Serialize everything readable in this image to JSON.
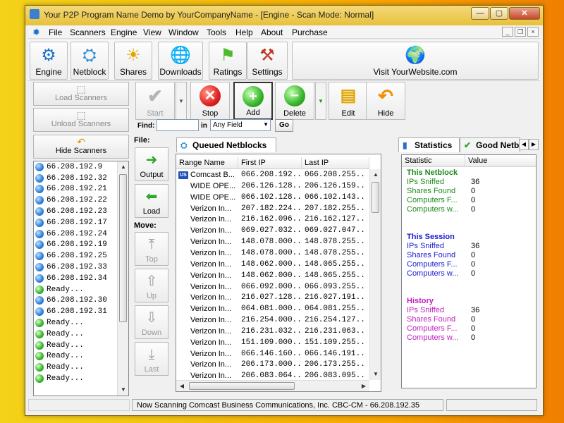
{
  "window": {
    "title": "Your P2P Program Name Demo by YourCompanyName - [Engine - Scan Mode: Normal]",
    "caption_buttons": [
      "—",
      "▢",
      "✕"
    ]
  },
  "menu": {
    "items": [
      "File",
      "Scanners",
      "Engine",
      "View",
      "Window",
      "Tools",
      "Help",
      "About",
      "Purchase"
    ],
    "mdi_controls": [
      "_",
      "❐",
      "×"
    ]
  },
  "toolbar": {
    "buttons": [
      {
        "label": "Engine",
        "icon": "gear-icon"
      },
      {
        "label": "Netblock",
        "icon": "netblock-icon"
      },
      {
        "label": "Shares",
        "icon": "shares-sun-icon"
      },
      {
        "label": "Downloads",
        "icon": "downloads-globe-icon"
      },
      {
        "label": "Ratings",
        "icon": "ratings-flag-icon"
      },
      {
        "label": "Settings",
        "icon": "settings-tools-icon"
      }
    ],
    "visit_label": "Visit YourWebsite.com"
  },
  "left_panel": {
    "load_scanners": "Load Scanners",
    "unload_scanners": "Unload Scanners",
    "hide_scanners": "Hide Scanners",
    "scanners": [
      {
        "text": "66.208.192.9",
        "status": "blue"
      },
      {
        "text": "66.208.192.32",
        "status": "blue"
      },
      {
        "text": "66.208.192.21",
        "status": "blue"
      },
      {
        "text": "66.208.192.22",
        "status": "blue"
      },
      {
        "text": "66.208.192.23",
        "status": "blue"
      },
      {
        "text": "66.208.192.17",
        "status": "blue"
      },
      {
        "text": "66.208.192.24",
        "status": "blue"
      },
      {
        "text": "66.208.192.19",
        "status": "blue"
      },
      {
        "text": "66.208.192.25",
        "status": "blue"
      },
      {
        "text": "66.208.192.33",
        "status": "blue"
      },
      {
        "text": "66.208.192.34",
        "status": "blue"
      },
      {
        "text": "Ready...",
        "status": "green"
      },
      {
        "text": "66.208.192.30",
        "status": "blue"
      },
      {
        "text": "66.208.192.31",
        "status": "blue"
      },
      {
        "text": "Ready...",
        "status": "green"
      },
      {
        "text": "Ready...",
        "status": "green"
      },
      {
        "text": "Ready...",
        "status": "green"
      },
      {
        "text": "Ready...",
        "status": "green"
      },
      {
        "text": "Ready...",
        "status": "green"
      },
      {
        "text": "Ready...",
        "status": "green"
      }
    ]
  },
  "main_tools": {
    "start": "Start",
    "stop": "Stop",
    "add": "Add",
    "delete": "Delete",
    "edit": "Edit",
    "hide": "Hide"
  },
  "find": {
    "label": "Find:",
    "in_label": "in",
    "field_value": "Any Field",
    "go": "Go",
    "value": ""
  },
  "file_move": {
    "file_heading": "File:",
    "output": "Output",
    "load": "Load",
    "move_heading": "Move:",
    "top": "Top",
    "up": "Up",
    "down": "Down",
    "last": "Last"
  },
  "queued": {
    "tab_label": "Queued Netblocks",
    "columns": [
      "Range Name",
      "First IP",
      "Last IP"
    ],
    "rows": [
      {
        "name": "Comcast B...",
        "first": "066.208.192...",
        "last": "066.208.255...",
        "flag": "US"
      },
      {
        "name": "WIDE OPE...",
        "first": "206.126.128...",
        "last": "206.126.159...",
        "flag": ""
      },
      {
        "name": "WIDE OPE...",
        "first": "066.102.128...",
        "last": "066.102.143...",
        "flag": ""
      },
      {
        "name": "Verizon In...",
        "first": "207.182.224...",
        "last": "207.182.255...",
        "flag": ""
      },
      {
        "name": "Verizon In...",
        "first": "216.162.096...",
        "last": "216.162.127...",
        "flag": ""
      },
      {
        "name": "Verizon In...",
        "first": "069.027.032...",
        "last": "069.027.047...",
        "flag": ""
      },
      {
        "name": "Verizon In...",
        "first": "148.078.000...",
        "last": "148.078.255...",
        "flag": ""
      },
      {
        "name": "Verizon In...",
        "first": "148.078.000...",
        "last": "148.078.255...",
        "flag": ""
      },
      {
        "name": "Verizon In...",
        "first": "148.062.000...",
        "last": "148.065.255...",
        "flag": ""
      },
      {
        "name": "Verizon In...",
        "first": "148.062.000...",
        "last": "148.065.255...",
        "flag": ""
      },
      {
        "name": "Verizon In...",
        "first": "066.092.000...",
        "last": "066.093.255...",
        "flag": ""
      },
      {
        "name": "Verizon In...",
        "first": "216.027.128...",
        "last": "216.027.191...",
        "flag": ""
      },
      {
        "name": "Verizon In...",
        "first": "064.081.000...",
        "last": "064.081.255...",
        "flag": ""
      },
      {
        "name": "Verizon In...",
        "first": "216.254.000...",
        "last": "216.254.127...",
        "flag": ""
      },
      {
        "name": "Verizon In...",
        "first": "216.231.032...",
        "last": "216.231.063...",
        "flag": ""
      },
      {
        "name": "Verizon In...",
        "first": "151.109.000...",
        "last": "151.109.255...",
        "flag": ""
      },
      {
        "name": "Verizon In...",
        "first": "066.146.160...",
        "last": "066.146.191...",
        "flag": ""
      },
      {
        "name": "Verizon In...",
        "first": "206.173.000...",
        "last": "206.173.255...",
        "flag": ""
      },
      {
        "name": "Verizon In...",
        "first": "206.083.064...",
        "last": "206.083.095...",
        "flag": ""
      }
    ]
  },
  "stats": {
    "tabs": [
      "Statistics",
      "Good Netb"
    ],
    "columns": [
      "Statistic",
      "Value"
    ],
    "sections": [
      {
        "title": "This Netblock",
        "color": "#1a8a1a",
        "rows": [
          {
            "k": "IPs Sniffed",
            "v": "36"
          },
          {
            "k": "Shares Found",
            "v": "0"
          },
          {
            "k": "Computers F...",
            "v": "0"
          },
          {
            "k": "Computers w...",
            "v": "0"
          }
        ]
      },
      {
        "title": "This Session",
        "color": "#1a1ad0",
        "rows": [
          {
            "k": "IPs Sniffed",
            "v": "36"
          },
          {
            "k": "Shares Found",
            "v": "0"
          },
          {
            "k": "Computers F...",
            "v": "0"
          },
          {
            "k": "Computers w...",
            "v": "0"
          }
        ]
      },
      {
        "title": "History",
        "color": "#c01ec0",
        "rows": [
          {
            "k": "IPs Sniffed",
            "v": "36"
          },
          {
            "k": "Shares Found",
            "v": "0"
          },
          {
            "k": "Computers F...",
            "v": "0"
          },
          {
            "k": "Computers w...",
            "v": "0"
          }
        ]
      }
    ]
  },
  "status": {
    "text": "Now Scanning Comcast Business Communications, Inc. CBC-CM - 66.208.192.35"
  }
}
